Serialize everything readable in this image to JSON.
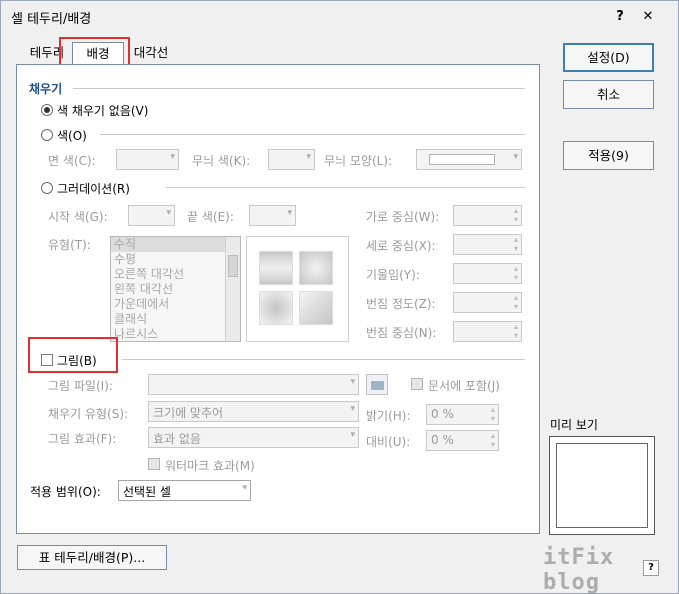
{
  "window": {
    "title": "셀 테두리/배경",
    "help_glyph": "?",
    "close_glyph": "✕"
  },
  "tabs": [
    {
      "label": "테두리"
    },
    {
      "label": "배경"
    },
    {
      "label": "대각선"
    }
  ],
  "fill": {
    "group_label": "채우기",
    "no_fill": "색 채우기 없음(V)",
    "color_option": "색(O)",
    "face_color": "면 색(C):",
    "pattern_color": "무늬 색(K):",
    "pattern_shape": "무늬 모양(L):",
    "gradient_option": "그러데이션(R)",
    "start_color": "시작 색(G):",
    "end_color": "끝 색(E):",
    "type_label": "유형(T):",
    "types": [
      "수직",
      "수평",
      "오른쪽 대각선",
      "왼쪽 대각선",
      "가운데에서",
      "클래식",
      "나르시스"
    ],
    "h_center": "가로 중심(W):",
    "v_center": "세로 중심(X):",
    "tilt": "기울임(Y):",
    "blur_amount": "번짐 정도(Z):",
    "blur_center": "번짐 중심(N):",
    "picture_option": "그림(B)",
    "picture_file": "그림 파일(I):",
    "include_in_doc": "문서에 포함(J)",
    "fill_type": "채우기 유형(S):",
    "fill_type_value": "크기에 맞추어",
    "brightness": "밝기(H):",
    "brightness_value": "0 %",
    "picture_effect": "그림 효과(F):",
    "picture_effect_value": "효과 없음",
    "contrast": "대비(U):",
    "contrast_value": "0 %",
    "watermark": "워터마크 효과(M)"
  },
  "apply_range": {
    "label": "적용 범위(O):",
    "value": "선택된 셀"
  },
  "buttons": {
    "ok": "설정(D)",
    "cancel": "취소",
    "apply": "적용(9)",
    "border_bg": "표 테두리/배경(P)..."
  },
  "preview": {
    "label": "미리 보기"
  },
  "watermark_text": "itFix blog"
}
